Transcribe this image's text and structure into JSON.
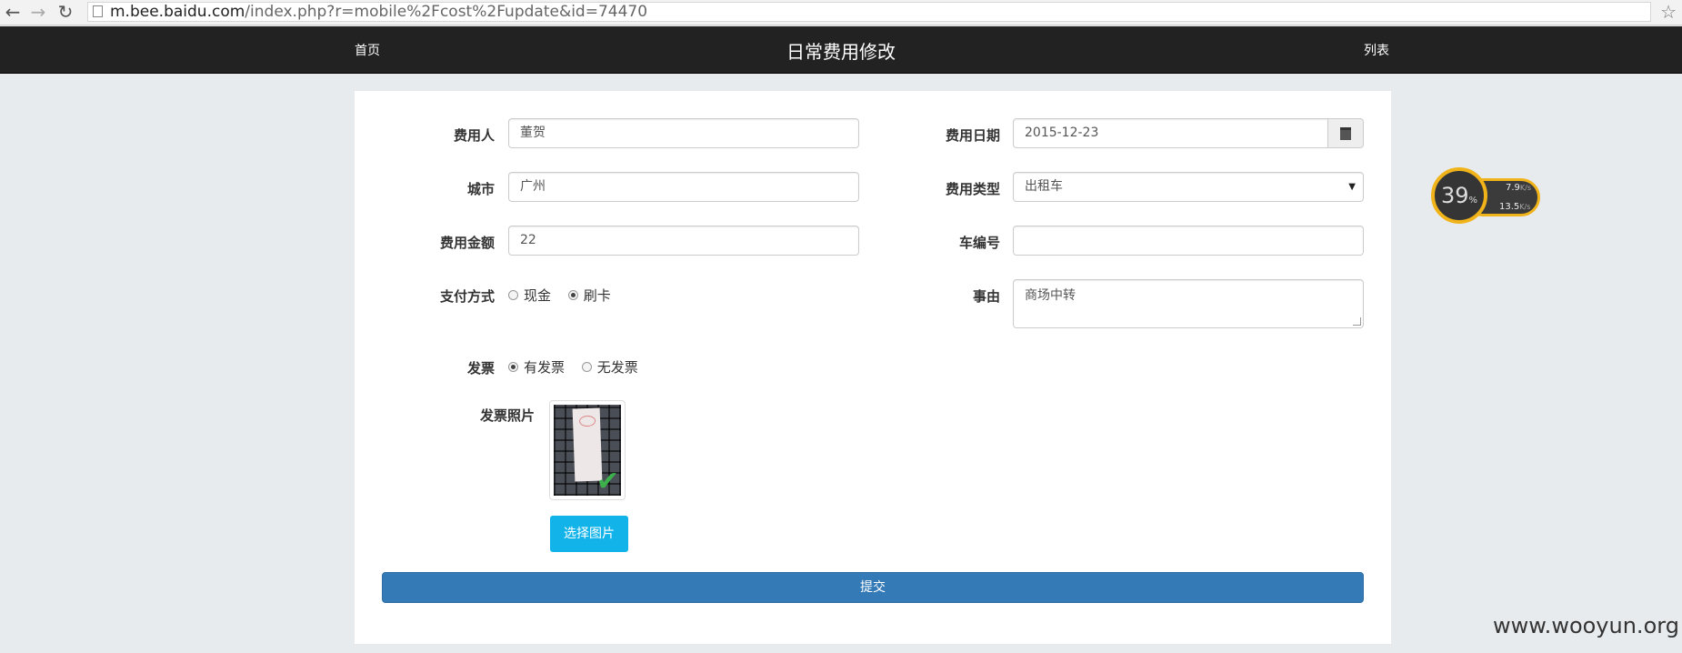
{
  "browser": {
    "url_host": "m.bee.baidu.com",
    "url_path": "/index.php?r=mobile%2Fcost%2Fupdate&id=74470"
  },
  "navbar": {
    "home": "首页",
    "title": "日常费用修改",
    "list": "列表"
  },
  "form": {
    "payer_label": "费用人",
    "payer_value": "董贺",
    "date_label": "费用日期",
    "date_value": "2015-12-23",
    "city_label": "城市",
    "city_value": "广州",
    "type_label": "费用类型",
    "type_value": "出租车",
    "amount_label": "费用金额",
    "amount_value": "22",
    "car_label": "车编号",
    "car_value": "",
    "payment_label": "支付方式",
    "payment_options": [
      "现金",
      "刷卡"
    ],
    "payment_selected": "刷卡",
    "reason_label": "事由",
    "reason_value": "商场中转",
    "invoice_label": "发票",
    "invoice_options": [
      "有发票",
      "无发票"
    ],
    "invoice_selected": "有发票",
    "photo_label": "发票照片",
    "choose_image": "选择图片",
    "submit": "提交"
  },
  "widget": {
    "percent": "39",
    "percent_sign": "%",
    "up_speed": "7.9",
    "down_speed": "13.5",
    "unit": "K/s"
  },
  "watermark": "www.wooyun.org",
  "colors": {
    "primary": "#337ab7",
    "info": "#12b3e9",
    "navbar": "#222222"
  }
}
